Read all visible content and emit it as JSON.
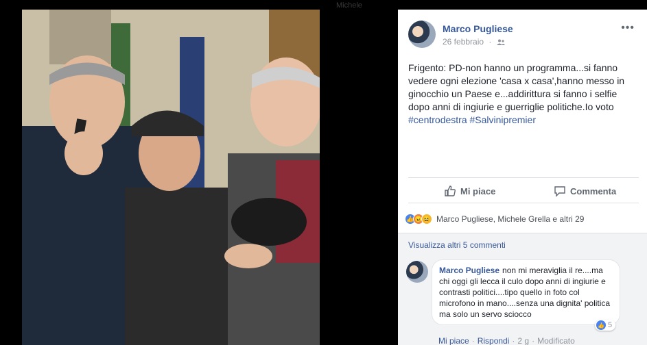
{
  "background": {
    "ghost_header": "Michele"
  },
  "post": {
    "author": "Marco Pugliese",
    "date": "26 febbraio",
    "audience_icon": "friends-icon",
    "more_icon": "more-icon",
    "more_label": "•••",
    "text_main": "Frigento: PD-non hanno un programma...si fanno vedere ogni elezione 'casa x casa',hanno messo in ginocchio un Paese e...addirittura si fanno i selfie dopo anni di ingiurie e guerriglie politiche.Io voto ",
    "hashtag1": "#centrodestra",
    "hashtag2": "#Salvinipremier"
  },
  "actions": {
    "like": "Mi piace",
    "comment": "Commenta"
  },
  "reactions": {
    "names": "Marco Pugliese, Michele Grella e altri 29"
  },
  "comments": {
    "view_more": "Visualizza altri 5 commenti",
    "items": [
      {
        "author": "Marco Pugliese",
        "text": "non mi meraviglia il re....ma chi oggi gli lecca il culo dopo anni di ingiurie e contrasti politici....tipo quello in foto col microfono in mano....senza una dignita' politica ma solo un servo sciocco",
        "reaction_count": "5",
        "like": "Mi piace",
        "reply": "Rispondi",
        "time": "2 g",
        "edited": "Modificato"
      }
    ]
  },
  "colors": {
    "link": "#365899",
    "panel_bg": "#ffffff",
    "comments_bg": "#f2f3f5"
  }
}
